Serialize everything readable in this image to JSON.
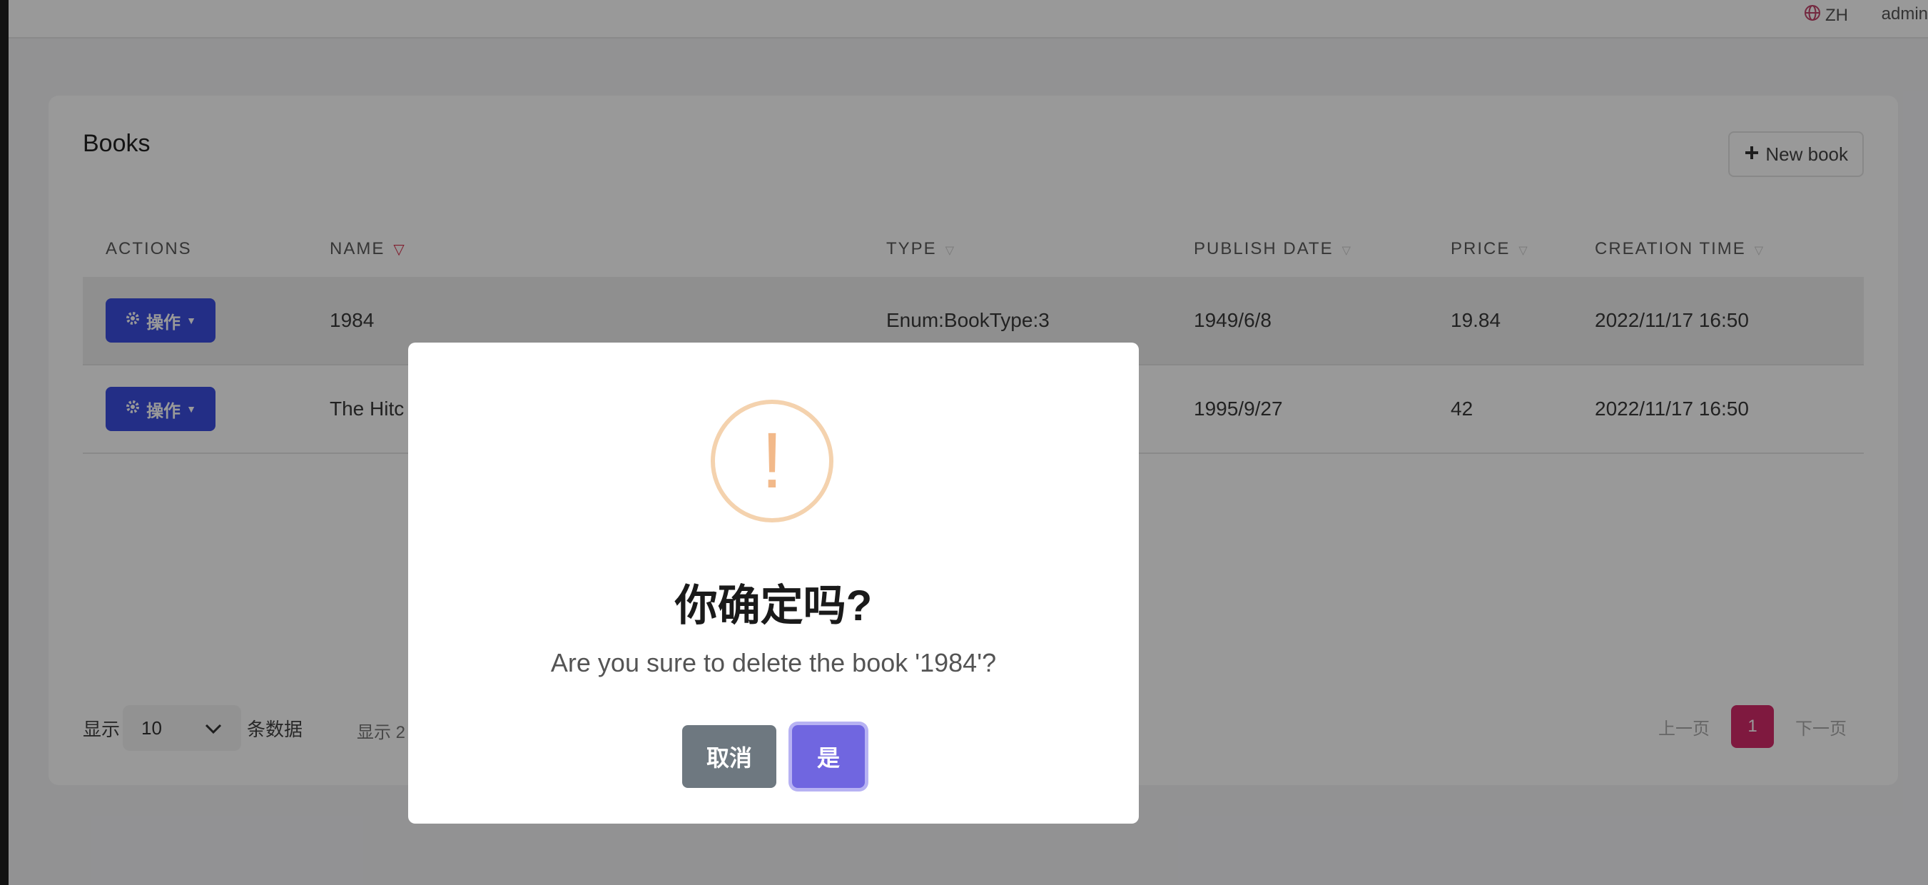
{
  "topbar": {
    "language": "ZH",
    "user": "admin"
  },
  "card": {
    "title": "Books",
    "new_button": "New book"
  },
  "table": {
    "headers": {
      "actions": "ACTIONS",
      "name": "NAME",
      "type": "TYPE",
      "publish_date": "PUBLISH DATE",
      "price": "PRICE",
      "creation_time": "CREATION TIME"
    },
    "rows": [
      {
        "action": "操作",
        "name": "1984",
        "type": "Enum:BookType:3",
        "publish_date": "1949/6/8",
        "price": "19.84",
        "creation_time": "2022/11/17 16:50"
      },
      {
        "action": "操作",
        "name": "The Hitc",
        "type": "",
        "publish_date": "1995/9/27",
        "price": "42",
        "creation_time": "2022/11/17 16:50"
      }
    ]
  },
  "footer": {
    "show_label": "显示",
    "page_size": "10",
    "rows_label": "条数据",
    "info": "显示 2",
    "prev": "上一页",
    "current_page": "1",
    "next": "下一页"
  },
  "dialog": {
    "icon": "warning-icon",
    "icon_glyph": "!",
    "title": "你确定吗?",
    "message": "Are you sure to delete the book '1984'?",
    "cancel": "取消",
    "confirm": "是"
  },
  "colors": {
    "action_button": "#3b4ee0",
    "pagination_active": "#d42b6a",
    "confirm_button": "#7066e0",
    "cancel_button": "#6e7880",
    "warning": "#f2b98a"
  }
}
